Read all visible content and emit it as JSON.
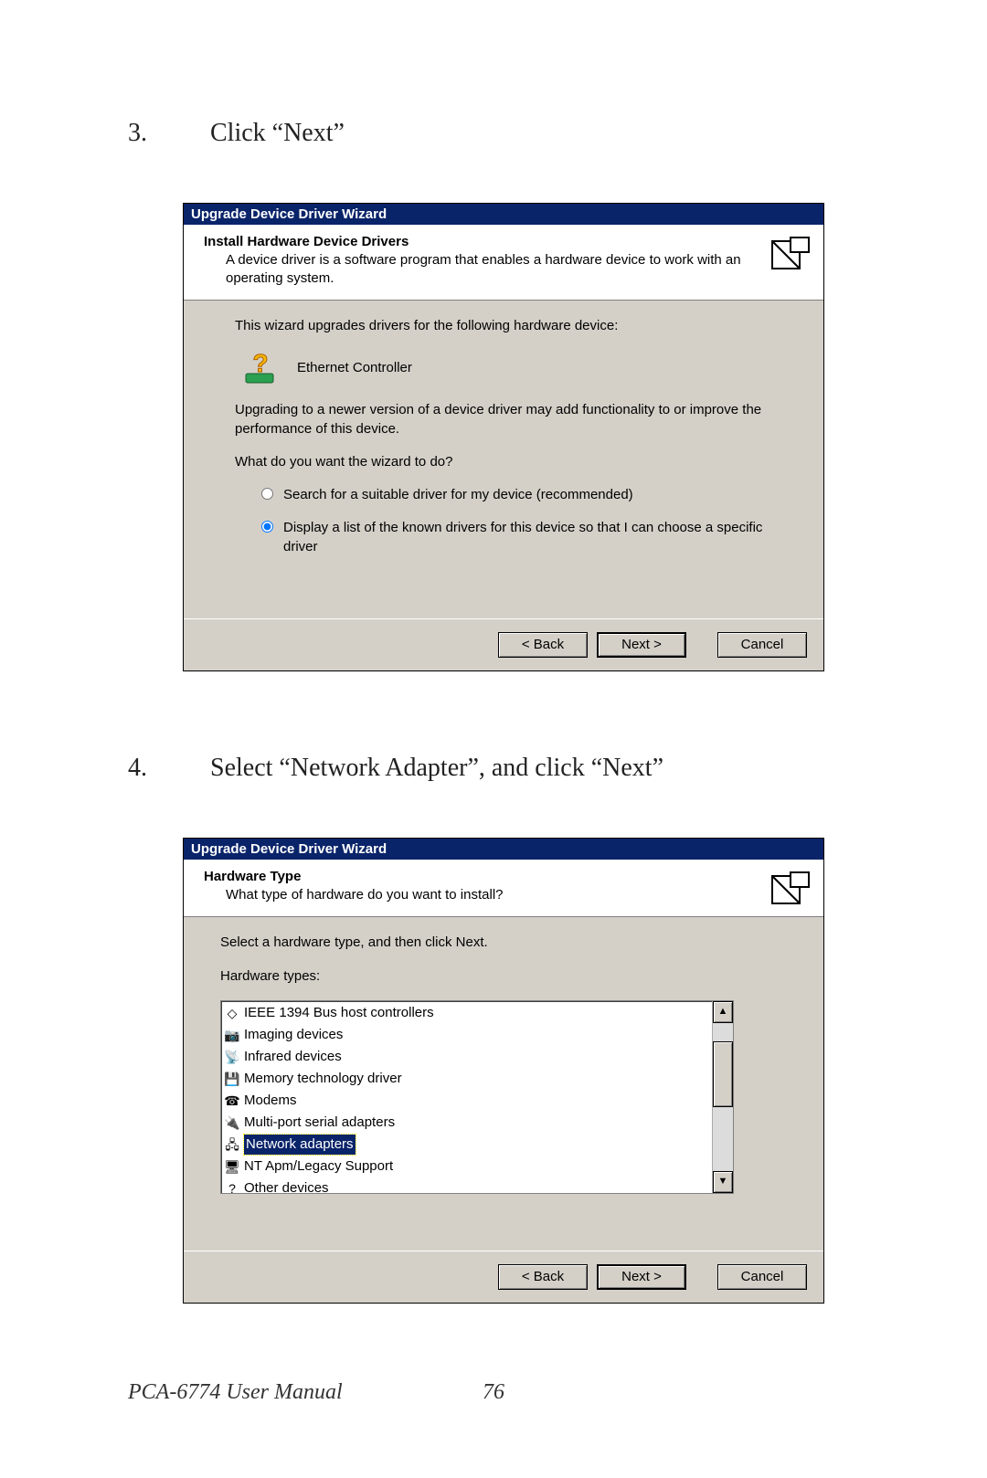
{
  "steps": {
    "s3": {
      "num": "3.",
      "text": "Click “Next”"
    },
    "s4": {
      "num": "4.",
      "text": "Select “Network Adapter”, and click “Next”"
    }
  },
  "dialog1": {
    "title": "Upgrade Device Driver Wizard",
    "header_title": "Install Hardware Device Drivers",
    "header_sub": "A device driver is a software program that enables a hardware device to work with an operating system.",
    "line_intro": "This wizard upgrades drivers for the following hardware device:",
    "device_name": "Ethernet Controller",
    "line_upgrade": "Upgrading to a newer version of a device driver may add functionality to or improve the performance of this device.",
    "line_question": "What do you want the wizard to do?",
    "radio1": "Search for a suitable driver for my device (recommended)",
    "radio2": "Display a list of the known drivers for this device so that I can choose a specific driver",
    "buttons": {
      "back": "< Back",
      "next": "Next >",
      "cancel": "Cancel"
    }
  },
  "dialog2": {
    "title": "Upgrade Device Driver Wizard",
    "header_title": "Hardware Type",
    "header_sub": "What type of hardware do you want to install?",
    "line_intro": "Select a hardware type, and then click Next.",
    "list_label": "Hardware types:",
    "items": [
      {
        "label": "IEEE 1394 Bus host controllers",
        "selected": false
      },
      {
        "label": "Imaging devices",
        "selected": false
      },
      {
        "label": "Infrared devices",
        "selected": false
      },
      {
        "label": "Memory technology driver",
        "selected": false
      },
      {
        "label": "Modems",
        "selected": false
      },
      {
        "label": "Multi-port serial adapters",
        "selected": false
      },
      {
        "label": "Network adapters",
        "selected": true
      },
      {
        "label": "NT Apm/Legacy Support",
        "selected": false
      },
      {
        "label": "Other devices",
        "selected": false
      }
    ],
    "buttons": {
      "back": "< Back",
      "next": "Next >",
      "cancel": "Cancel"
    }
  },
  "footer": {
    "manual": "PCA-6774 User Manual",
    "page": "76"
  }
}
